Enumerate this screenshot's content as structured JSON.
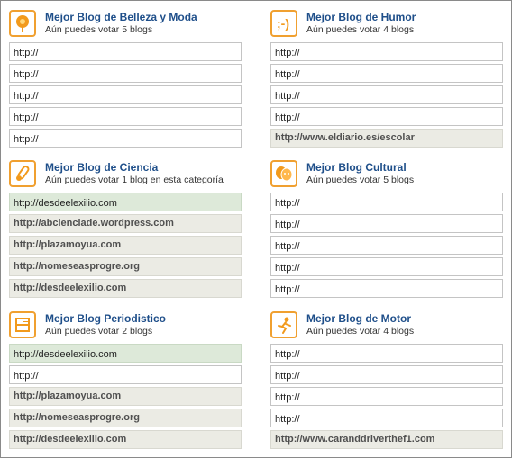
{
  "categories": [
    {
      "id": "belleza",
      "icon": "flower-icon",
      "title": "Mejor Blog de Belleza y Moda",
      "subtitle": "Aún puedes votar 5 blogs",
      "entries": [
        {
          "value": "http://",
          "state": "empty"
        },
        {
          "value": "http://",
          "state": "empty"
        },
        {
          "value": "http://",
          "state": "empty"
        },
        {
          "value": "http://",
          "state": "empty"
        },
        {
          "value": "http://",
          "state": "empty"
        }
      ]
    },
    {
      "id": "humor",
      "icon": "winking-face-icon",
      "title": "Mejor Blog de Humor",
      "subtitle": "Aún puedes votar 4 blogs",
      "entries": [
        {
          "value": "http://",
          "state": "empty"
        },
        {
          "value": "http://",
          "state": "empty"
        },
        {
          "value": "http://",
          "state": "empty"
        },
        {
          "value": "http://",
          "state": "empty"
        },
        {
          "value": "http://www.eldiario.es/escolar",
          "state": "filled"
        }
      ]
    },
    {
      "id": "ciencia",
      "icon": "test-tube-icon",
      "title": "Mejor Blog de Ciencia",
      "subtitle": "Aún puedes votar 1 blog en esta categoría",
      "entries": [
        {
          "value": "http://desdeelexilio.com",
          "state": "active"
        },
        {
          "value": "http://abcienciade.wordpress.com",
          "state": "filled"
        },
        {
          "value": "http://plazamoyua.com",
          "state": "filled"
        },
        {
          "value": "http://nomeseasprogre.org",
          "state": "filled"
        },
        {
          "value": "http://desdeelexilio.com",
          "state": "filled"
        }
      ]
    },
    {
      "id": "cultural",
      "icon": "theater-masks-icon",
      "title": "Mejor Blog Cultural",
      "subtitle": "Aún puedes votar 5 blogs",
      "entries": [
        {
          "value": "http://",
          "state": "empty"
        },
        {
          "value": "http://",
          "state": "empty"
        },
        {
          "value": "http://",
          "state": "empty"
        },
        {
          "value": "http://",
          "state": "empty"
        },
        {
          "value": "http://",
          "state": "empty"
        }
      ]
    },
    {
      "id": "periodistico",
      "icon": "newspaper-icon",
      "title": "Mejor Blog Periodistico",
      "subtitle": "Aún puedes votar 2 blogs",
      "entries": [
        {
          "value": "http://desdeelexilio.com",
          "state": "active"
        },
        {
          "value": "http://",
          "state": "empty"
        },
        {
          "value": "http://plazamoyua.com",
          "state": "filled"
        },
        {
          "value": "http://nomeseasprogre.org",
          "state": "filled"
        },
        {
          "value": "http://desdeelexilio.com",
          "state": "filled"
        }
      ]
    },
    {
      "id": "motor",
      "icon": "racing-driver-icon",
      "title": "Mejor Blog de Motor",
      "subtitle": "Aún puedes votar 4 blogs",
      "entries": [
        {
          "value": "http://",
          "state": "empty"
        },
        {
          "value": "http://",
          "state": "empty"
        },
        {
          "value": "http://",
          "state": "empty"
        },
        {
          "value": "http://",
          "state": "empty"
        },
        {
          "value": "http://www.caranddriverthef1.com",
          "state": "filled"
        }
      ]
    }
  ],
  "colors": {
    "title": "#1f4f8a",
    "icon_border": "#f0a030",
    "filled_bg": "#ebebe4",
    "active_bg": "#dde9d9"
  }
}
